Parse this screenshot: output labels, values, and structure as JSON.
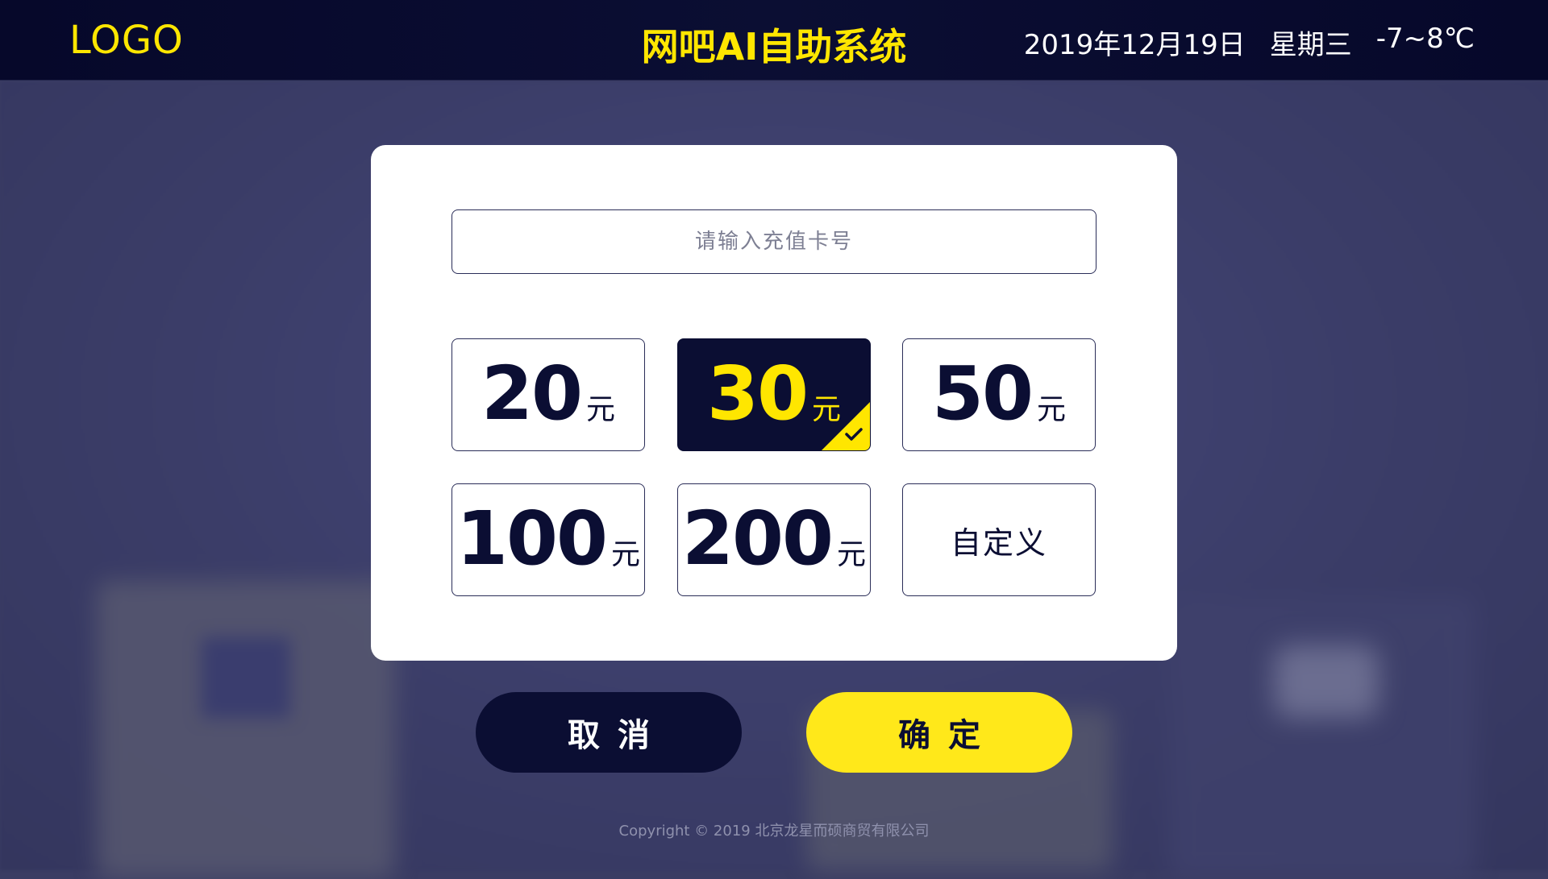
{
  "header": {
    "logo": "LOGO",
    "title": "网吧AI自助系统",
    "date": "2019年12月19日",
    "weekday": "星期三",
    "temperature": "-7~8℃"
  },
  "dialog": {
    "card_input": {
      "placeholder": "请输入充值卡号",
      "value": ""
    },
    "currency_unit": "元",
    "amounts": [
      {
        "value": "20",
        "selected": false
      },
      {
        "value": "30",
        "selected": true
      },
      {
        "value": "50",
        "selected": false
      },
      {
        "value": "100",
        "selected": false
      },
      {
        "value": "200",
        "selected": false
      }
    ],
    "custom_label": "自定义"
  },
  "actions": {
    "cancel_label": "取消",
    "confirm_label": "确定"
  },
  "footer": {
    "copyright": "Copyright © 2019  北京龙星而硕商贸有限公司"
  },
  "colors": {
    "accent_yellow": "#ffe600",
    "navy": "#0b0e33",
    "backdrop": "#3a3c63"
  },
  "icons": {
    "selected_marker": "checkmark-icon"
  }
}
